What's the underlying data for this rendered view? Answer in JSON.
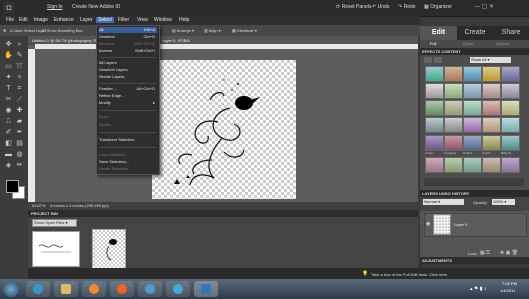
{
  "topbar": {
    "sign_in": "Sign In",
    "create_id": "Create New Adobe ID",
    "reset_panels": "Reset Panels",
    "undo": "Undo",
    "redo": "Redo",
    "organizer": "Organizer"
  },
  "menubar": [
    "File",
    "Edit",
    "Image",
    "Enhance",
    "Layer",
    "Select",
    "Filter",
    "View",
    "Window",
    "Help"
  ],
  "options": {
    "auto_select": "Auto Select Layer",
    "show_bounding": "Show Bounding Box",
    "arrange": "Arrange",
    "align": "Align",
    "distribute": "Distribute"
  },
  "document": {
    "title": "Untitled-1 @ 66.7% (photography, RGB/8)",
    "layer_tab": "Layer 0, RGB/8",
    "zoom": "66.67%",
    "size": "4 inches x 4 inches (299.999 ppi)"
  },
  "select_menu": [
    {
      "label": "All",
      "shortcut": "Ctrl+A",
      "state": "highlight"
    },
    {
      "label": "Deselect",
      "shortcut": "Ctrl+D",
      "state": "normal"
    },
    {
      "label": "Reselect",
      "shortcut": "Shift+Ctrl+D",
      "state": "disabled"
    },
    {
      "label": "Inverse",
      "shortcut": "Shift+Ctrl+I",
      "state": "normal"
    },
    {
      "label": "All Layers",
      "shortcut": "",
      "state": "normal"
    },
    {
      "label": "Deselect Layers",
      "shortcut": "",
      "state": "normal"
    },
    {
      "label": "Similar Layers",
      "shortcut": "",
      "state": "normal"
    },
    {
      "label": "Feather...",
      "shortcut": "Alt+Ctrl+D",
      "state": "normal"
    },
    {
      "label": "Refine Edge...",
      "shortcut": "",
      "state": "normal"
    },
    {
      "label": "Modify",
      "shortcut": "",
      "state": "normal"
    },
    {
      "label": "Grow",
      "shortcut": "",
      "state": "disabled"
    },
    {
      "label": "Similar",
      "shortcut": "",
      "state": "disabled"
    },
    {
      "label": "Transform Selection",
      "shortcut": "",
      "state": "normal"
    },
    {
      "label": "Load Selection...",
      "shortcut": "",
      "state": "disabled"
    },
    {
      "label": "Save Selection...",
      "shortcut": "",
      "state": "normal"
    },
    {
      "label": "Delete Selection...",
      "shortcut": "",
      "state": "disabled"
    }
  ],
  "project_bin": {
    "header": "PROJECT BIN",
    "dropdown": "Show Open Files"
  },
  "right_panel": {
    "tabs": [
      "Edit",
      "Create",
      "Share"
    ],
    "subtabs": [
      "Full",
      "Quick",
      "Guided"
    ],
    "effects_header": "EFFECTS  CONTENT",
    "content_dropdown": "Show All",
    "content_labels": [
      "Arrow",
      "Camping",
      "Collect..",
      "Colorf..",
      "Baby B.."
    ],
    "layers_header": "LAYERS  UNDO HISTORY",
    "blend_mode": "Normal",
    "opacity_label": "Opacity:",
    "opacity_value": "100%",
    "layer_name": "Layer 0",
    "lock_label": "Lock:",
    "adjustments_header": "ADJUSTMENTS"
  },
  "tip": "Take a tour of the Full Edit tools. Click here.",
  "taskbar": {
    "time": "7:08 PM",
    "date": "1/4/2011"
  },
  "colors": {
    "accent": "#3c5e9a",
    "menu_bg": "#2e2e2e"
  }
}
